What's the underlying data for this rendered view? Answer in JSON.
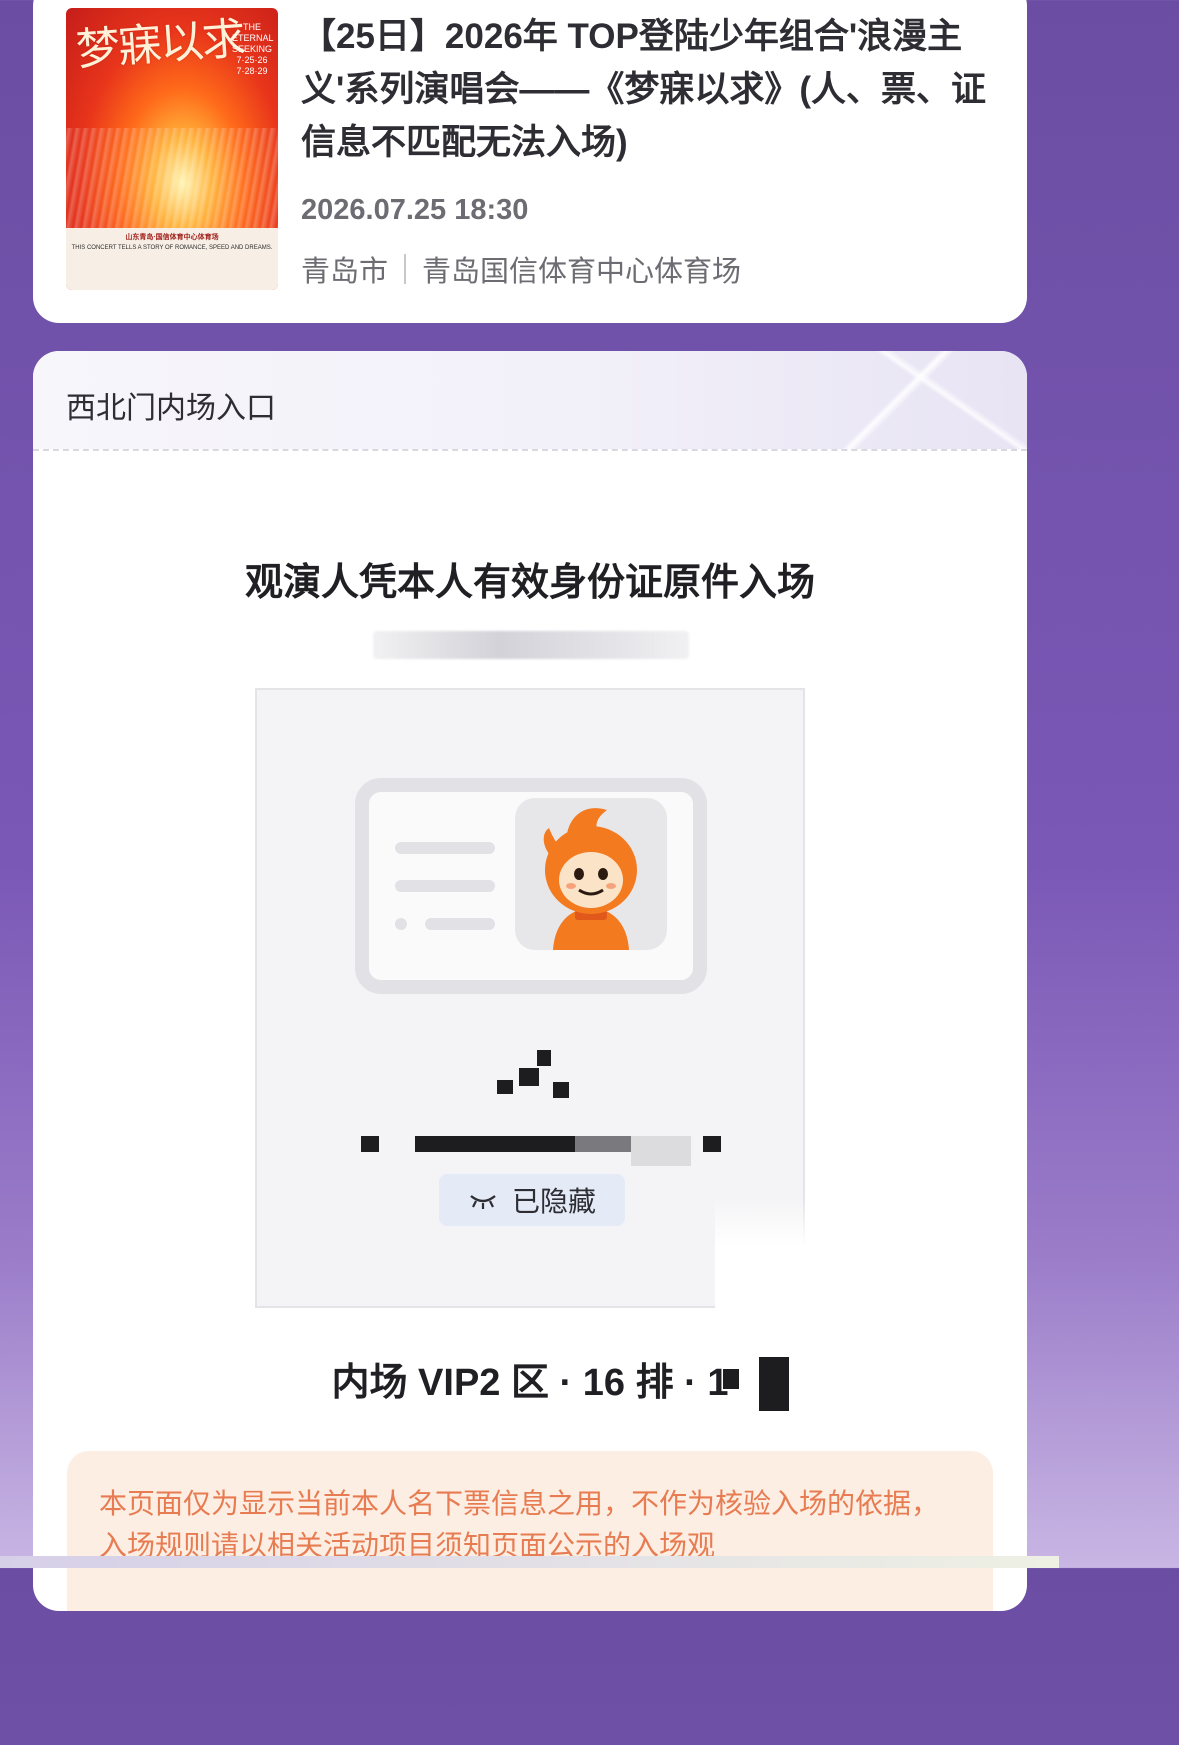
{
  "event": {
    "poster_title": "梦寐以求",
    "poster_side_text": "THE ETERNAL SEEKING 7·25·26 7·28·29",
    "poster_venue": "山东青岛·国信体育中心体育场",
    "poster_tagline": "THIS CONCERT TELLS A STORY OF ROMANCE, SPEED AND DREAMS.",
    "title": "【25日】2026年 TOP登陆少年组合'浪漫主义'系列演唱会——《梦寐以求》(人、票、证信息不匹配无法入场)",
    "datetime": "2026.07.25 18:30",
    "city": "青岛市",
    "venue": "青岛国信体育中心体育场"
  },
  "ticket": {
    "gate": "西北门内场入口",
    "entry_note": "观演人凭本人有效身份证原件入场",
    "hidden_badge": "已隐藏",
    "seat_visible": "内场 VIP2 区 · 16 排 · 1",
    "disclaimer": "本页面仅为显示当前本人名下票信息之用，不作为核验入场的依据，入场规则请以相关活动项目须知页面公示的入场观"
  },
  "colors": {
    "background_purple": "#6b4ea3",
    "card_white": "#ffffff",
    "disclaimer_bg": "#fdeee3",
    "disclaimer_text": "#e77c52",
    "hidden_badge_bg": "#e4ebf6",
    "mascot_orange": "#f47a1f"
  },
  "icons": {
    "hidden": "closed-eye-icon",
    "mascot": "mascot-avatar-icon"
  }
}
